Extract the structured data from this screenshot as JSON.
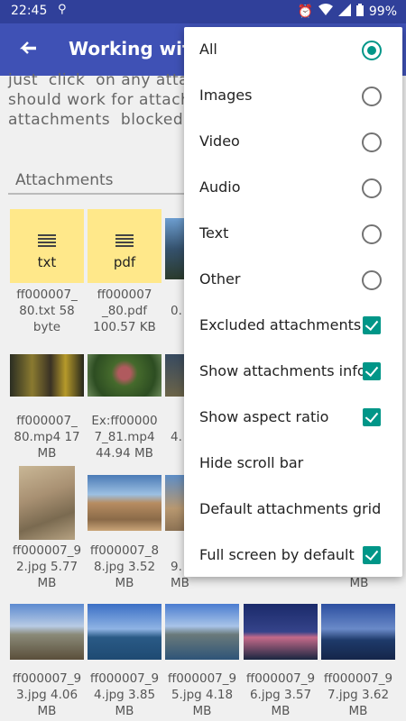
{
  "status_bar": {
    "time": "22:45",
    "battery": "99%"
  },
  "app_bar": {
    "title": "Working with attachments"
  },
  "description": "just  click  on any attachment\nshould work for attachments\nattachments  blocked  with",
  "section": {
    "title": "Attachments"
  },
  "tiles": [
    {
      "ext": "txt",
      "caption": "ff000007_\n80.txt 58\nbyte"
    },
    {
      "ext": "pdf",
      "caption": "ff000007\n_80.pdf\n100.57 KB"
    },
    {
      "caption": "0."
    },
    {
      "caption": "ff000007_\n80.mp4 17\nMB"
    },
    {
      "caption": "Ex:ff00000\n7_81.mp4\n44.94 MB"
    },
    {
      "caption": "4."
    },
    {
      "caption": "ff000007_9\n2.jpg 5.77\nMB"
    },
    {
      "caption": "ff000007_8\n8.jpg 3.52\nMB"
    },
    {
      "caption": "9.\nMB"
    },
    {
      "caption": "MB"
    },
    {
      "caption": "ff000007_9\n3.jpg 4.06\nMB"
    },
    {
      "caption": "ff000007_9\n4.jpg 3.85\nMB"
    },
    {
      "caption": "ff000007_9\n5.jpg 4.18\nMB"
    },
    {
      "caption": "ff000007_9\n6.jpg 3.57\nMB"
    },
    {
      "caption": "ff000007_9\n7.jpg 3.62\nMB"
    }
  ],
  "menu": {
    "items": [
      {
        "label": "All",
        "control": "radio",
        "checked": true
      },
      {
        "label": "Images",
        "control": "radio",
        "checked": false
      },
      {
        "label": "Video",
        "control": "radio",
        "checked": false
      },
      {
        "label": "Audio",
        "control": "radio",
        "checked": false
      },
      {
        "label": "Text",
        "control": "radio",
        "checked": false
      },
      {
        "label": "Other",
        "control": "radio",
        "checked": false
      },
      {
        "label": "Excluded attachments",
        "control": "checkbox",
        "checked": true
      },
      {
        "label": "Show attachments info",
        "control": "checkbox",
        "checked": true
      },
      {
        "label": "Show aspect ratio",
        "control": "checkbox",
        "checked": true
      },
      {
        "label": "Hide scroll bar",
        "control": "none"
      },
      {
        "label": "Default attachments grid",
        "control": "none"
      },
      {
        "label": "Full screen by default",
        "control": "checkbox",
        "checked": true
      }
    ]
  },
  "colors": {
    "primary": "#3f51b5",
    "status": "#30409a",
    "accent": "#009688",
    "doc_tile": "#ffe88a"
  }
}
